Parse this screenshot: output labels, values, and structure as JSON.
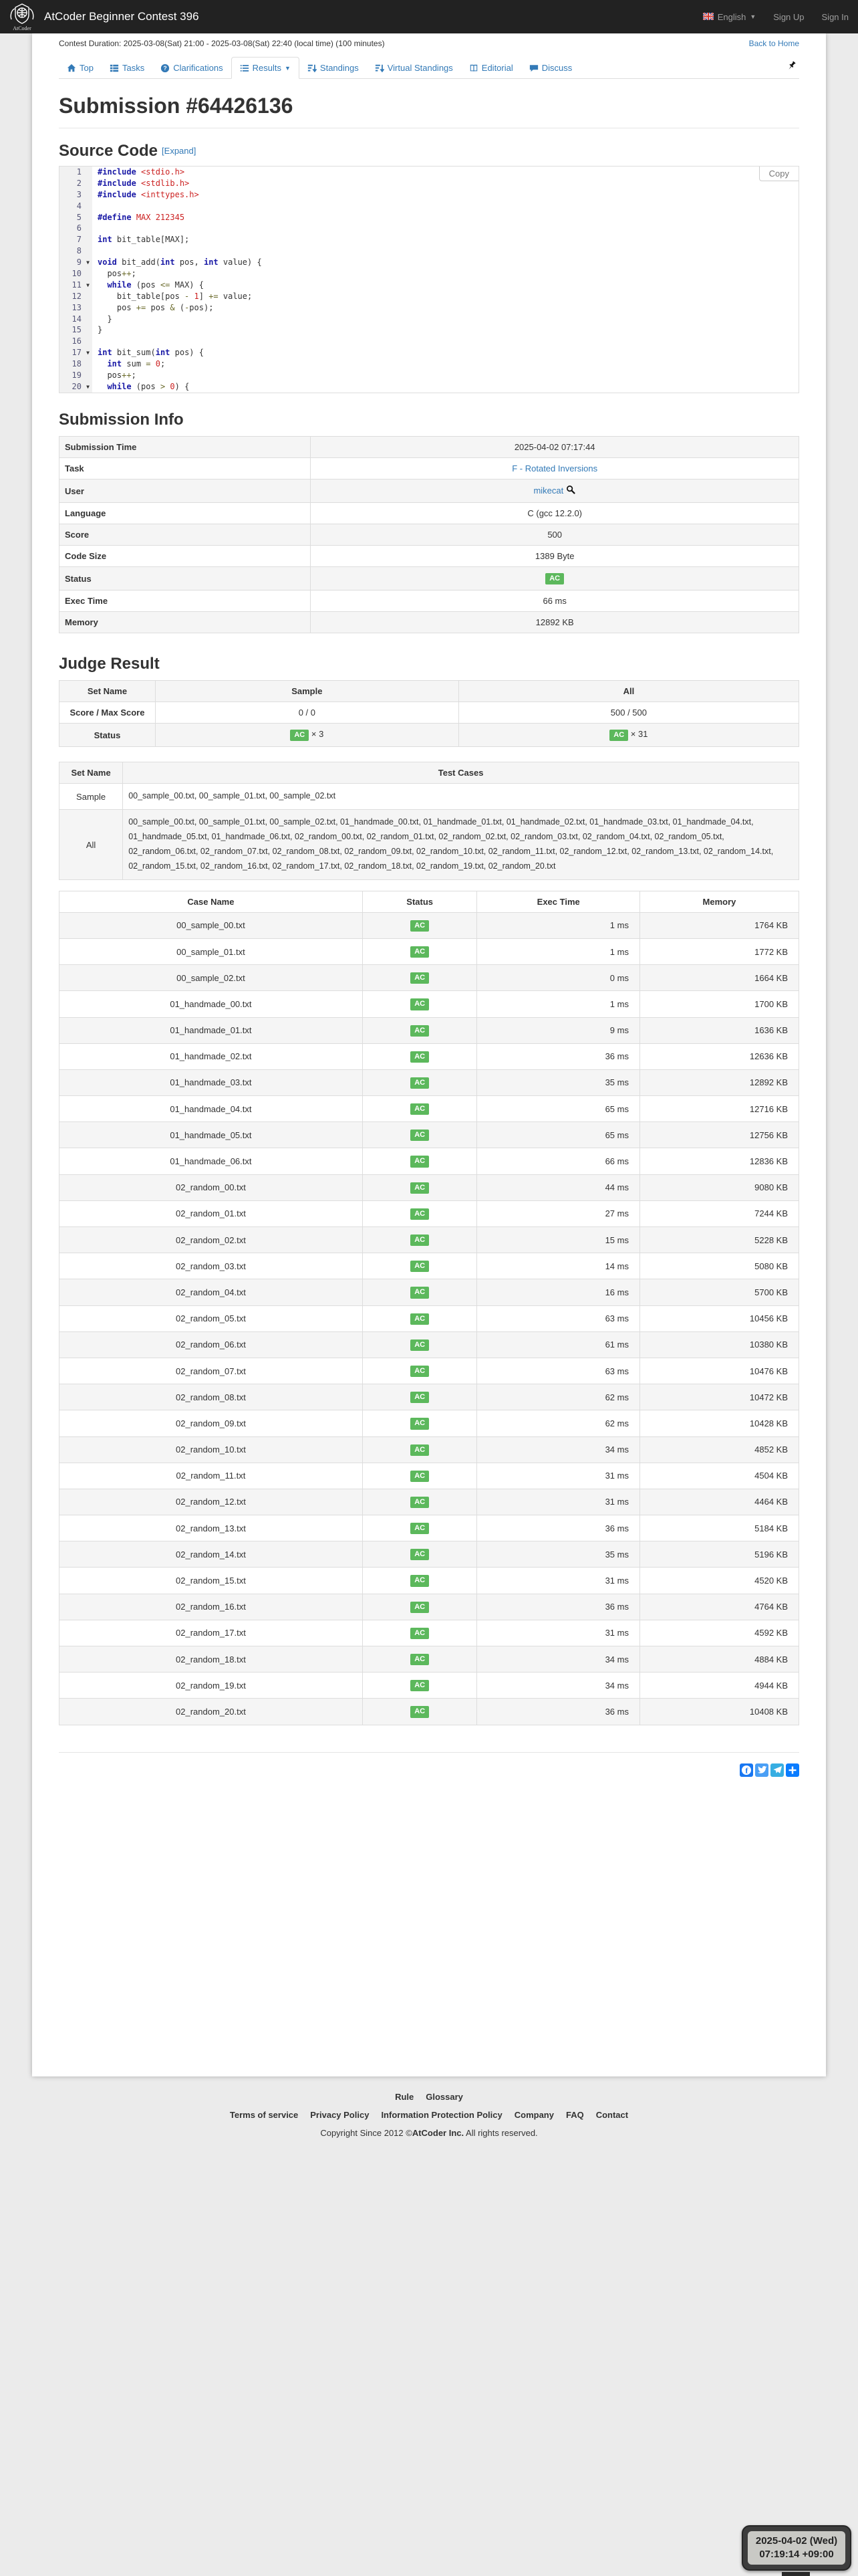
{
  "colors": {
    "accent_link": "#337ab7",
    "ac_green": "#5cb85c",
    "navbar_bg": "#222222",
    "facebook": "#1877f2",
    "twitter": "#4a9ff5",
    "telegram": "#37aee2",
    "more": "#0a7cff"
  },
  "navbar": {
    "brand": "AtCoder Beginner Contest 396",
    "language": "English",
    "sign_up": "Sign Up",
    "sign_in": "Sign In"
  },
  "topbar": {
    "contest_duration": "Contest Duration: 2025-03-08(Sat) 21:00 - 2025-03-08(Sat) 22:40 (local time) (100 minutes)",
    "back_to_home": "Back to Home"
  },
  "tabs": [
    {
      "label": "Top",
      "icon": "home-icon",
      "active": false,
      "caret": false
    },
    {
      "label": "Tasks",
      "icon": "tasks-icon",
      "active": false,
      "caret": false
    },
    {
      "label": "Clarifications",
      "icon": "clarifications-icon",
      "active": false,
      "caret": false
    },
    {
      "label": "Results",
      "icon": "results-icon",
      "active": true,
      "caret": true
    },
    {
      "label": "Standings",
      "icon": "standings-icon",
      "active": false,
      "caret": false
    },
    {
      "label": "Virtual Standings",
      "icon": "virtual-standings-icon",
      "active": false,
      "caret": false
    },
    {
      "label": "Editorial",
      "icon": "editorial-icon",
      "active": false,
      "caret": false
    },
    {
      "label": "Discuss",
      "icon": "discuss-icon",
      "active": false,
      "caret": false
    }
  ],
  "page": {
    "title": "Submission #64426136"
  },
  "source_code": {
    "heading": "Source Code",
    "expand_label": "[Expand]",
    "copy_label": "Copy",
    "lines": [
      {
        "n": "1",
        "fold": false,
        "t": [
          [
            "k",
            "#include"
          ],
          [
            "p",
            " "
          ],
          [
            "s",
            "<stdio.h>"
          ]
        ]
      },
      {
        "n": "2",
        "fold": false,
        "t": [
          [
            "k",
            "#include"
          ],
          [
            "p",
            " "
          ],
          [
            "s",
            "<stdlib.h>"
          ]
        ]
      },
      {
        "n": "3",
        "fold": false,
        "t": [
          [
            "k",
            "#include"
          ],
          [
            "p",
            " "
          ],
          [
            "s",
            "<inttypes.h>"
          ]
        ]
      },
      {
        "n": "4",
        "fold": false,
        "t": []
      },
      {
        "n": "5",
        "fold": false,
        "t": [
          [
            "k",
            "#define"
          ],
          [
            "p",
            " "
          ],
          [
            "l",
            "MAX 212345"
          ]
        ]
      },
      {
        "n": "6",
        "fold": false,
        "t": []
      },
      {
        "n": "7",
        "fold": false,
        "t": [
          [
            "k",
            "int"
          ],
          [
            "p",
            " bit_table[MAX];"
          ]
        ]
      },
      {
        "n": "8",
        "fold": false,
        "t": []
      },
      {
        "n": "9",
        "fold": true,
        "t": [
          [
            "k",
            "void"
          ],
          [
            "p",
            " bit_add("
          ],
          [
            "k",
            "int"
          ],
          [
            "p",
            " pos, "
          ],
          [
            "k",
            "int"
          ],
          [
            "p",
            " value) {"
          ]
        ]
      },
      {
        "n": "10",
        "fold": false,
        "t": [
          [
            "p",
            "  pos"
          ],
          [
            "o",
            "++"
          ],
          [
            "p",
            ";"
          ]
        ]
      },
      {
        "n": "11",
        "fold": true,
        "t": [
          [
            "p",
            "  "
          ],
          [
            "k",
            "while"
          ],
          [
            "p",
            " (pos "
          ],
          [
            "o",
            "<="
          ],
          [
            "p",
            " MAX) {"
          ]
        ]
      },
      {
        "n": "12",
        "fold": false,
        "t": [
          [
            "p",
            "    bit_table[pos "
          ],
          [
            "o",
            "-"
          ],
          [
            "p",
            " "
          ],
          [
            "l",
            "1"
          ],
          [
            "p",
            "] "
          ],
          [
            "o",
            "+="
          ],
          [
            "p",
            " value;"
          ]
        ]
      },
      {
        "n": "13",
        "fold": false,
        "t": [
          [
            "p",
            "    pos "
          ],
          [
            "o",
            "+="
          ],
          [
            "p",
            " pos "
          ],
          [
            "o",
            "&"
          ],
          [
            "p",
            " ("
          ],
          [
            "o",
            "-"
          ],
          [
            "p",
            "pos);"
          ]
        ]
      },
      {
        "n": "14",
        "fold": false,
        "t": [
          [
            "p",
            "  }"
          ]
        ]
      },
      {
        "n": "15",
        "fold": false,
        "t": [
          [
            "p",
            "}"
          ]
        ]
      },
      {
        "n": "16",
        "fold": false,
        "t": []
      },
      {
        "n": "17",
        "fold": true,
        "t": [
          [
            "k",
            "int"
          ],
          [
            "p",
            " bit_sum("
          ],
          [
            "k",
            "int"
          ],
          [
            "p",
            " pos) {"
          ]
        ]
      },
      {
        "n": "18",
        "fold": false,
        "t": [
          [
            "p",
            "  "
          ],
          [
            "k",
            "int"
          ],
          [
            "p",
            " sum "
          ],
          [
            "o",
            "="
          ],
          [
            "p",
            " "
          ],
          [
            "l",
            "0"
          ],
          [
            "p",
            ";"
          ]
        ]
      },
      {
        "n": "19",
        "fold": false,
        "t": [
          [
            "p",
            "  pos"
          ],
          [
            "o",
            "++"
          ],
          [
            "p",
            ";"
          ]
        ]
      },
      {
        "n": "20",
        "fold": true,
        "t": [
          [
            "p",
            "  "
          ],
          [
            "k",
            "while"
          ],
          [
            "p",
            " (pos "
          ],
          [
            "o",
            ">"
          ],
          [
            "p",
            " "
          ],
          [
            "l",
            "0"
          ],
          [
            "p",
            ") {"
          ]
        ]
      }
    ]
  },
  "submission_info": {
    "heading": "Submission Info",
    "rows": [
      {
        "label": "Submission Time",
        "value": "2025-04-02 07:17:44",
        "type": "text"
      },
      {
        "label": "Task",
        "value": "F - Rotated Inversions",
        "type": "link"
      },
      {
        "label": "User",
        "value": "mikecat",
        "type": "user"
      },
      {
        "label": "Language",
        "value": "C (gcc 12.2.0)",
        "type": "text"
      },
      {
        "label": "Score",
        "value": "500",
        "type": "text"
      },
      {
        "label": "Code Size",
        "value": "1389 Byte",
        "type": "text"
      },
      {
        "label": "Status",
        "value": "AC",
        "type": "badge"
      },
      {
        "label": "Exec Time",
        "value": "66 ms",
        "type": "text"
      },
      {
        "label": "Memory",
        "value": "12892 KB",
        "type": "text"
      }
    ]
  },
  "judge_result": {
    "heading": "Judge Result",
    "headers": [
      "Set Name",
      "Sample",
      "All"
    ],
    "score_row": {
      "label": "Score / Max Score",
      "sample": "0 / 0",
      "all": "500 / 500"
    },
    "status_row": {
      "label": "Status",
      "sample_badge": "AC",
      "sample_count": "× 3",
      "all_badge": "AC",
      "all_count": "× 31"
    }
  },
  "test_cases": {
    "headers": [
      "Set Name",
      "Test Cases"
    ],
    "rows": [
      {
        "set": "Sample",
        "cases": "00_sample_00.txt, 00_sample_01.txt, 00_sample_02.txt"
      },
      {
        "set": "All",
        "cases": "00_sample_00.txt, 00_sample_01.txt, 00_sample_02.txt, 01_handmade_00.txt, 01_handmade_01.txt, 01_handmade_02.txt, 01_handmade_03.txt, 01_handmade_04.txt, 01_handmade_05.txt, 01_handmade_06.txt, 02_random_00.txt, 02_random_01.txt, 02_random_02.txt, 02_random_03.txt, 02_random_04.txt, 02_random_05.txt, 02_random_06.txt, 02_random_07.txt, 02_random_08.txt, 02_random_09.txt, 02_random_10.txt, 02_random_11.txt, 02_random_12.txt, 02_random_13.txt, 02_random_14.txt, 02_random_15.txt, 02_random_16.txt, 02_random_17.txt, 02_random_18.txt, 02_random_19.txt, 02_random_20.txt"
      }
    ]
  },
  "case_results": {
    "headers": [
      "Case Name",
      "Status",
      "Exec Time",
      "Memory"
    ],
    "rows": [
      [
        "00_sample_00.txt",
        "AC",
        "1 ms",
        "1764 KB"
      ],
      [
        "00_sample_01.txt",
        "AC",
        "1 ms",
        "1772 KB"
      ],
      [
        "00_sample_02.txt",
        "AC",
        "0 ms",
        "1664 KB"
      ],
      [
        "01_handmade_00.txt",
        "AC",
        "1 ms",
        "1700 KB"
      ],
      [
        "01_handmade_01.txt",
        "AC",
        "9 ms",
        "1636 KB"
      ],
      [
        "01_handmade_02.txt",
        "AC",
        "36 ms",
        "12636 KB"
      ],
      [
        "01_handmade_03.txt",
        "AC",
        "35 ms",
        "12892 KB"
      ],
      [
        "01_handmade_04.txt",
        "AC",
        "65 ms",
        "12716 KB"
      ],
      [
        "01_handmade_05.txt",
        "AC",
        "65 ms",
        "12756 KB"
      ],
      [
        "01_handmade_06.txt",
        "AC",
        "66 ms",
        "12836 KB"
      ],
      [
        "02_random_00.txt",
        "AC",
        "44 ms",
        "9080 KB"
      ],
      [
        "02_random_01.txt",
        "AC",
        "27 ms",
        "7244 KB"
      ],
      [
        "02_random_02.txt",
        "AC",
        "15 ms",
        "5228 KB"
      ],
      [
        "02_random_03.txt",
        "AC",
        "14 ms",
        "5080 KB"
      ],
      [
        "02_random_04.txt",
        "AC",
        "16 ms",
        "5700 KB"
      ],
      [
        "02_random_05.txt",
        "AC",
        "63 ms",
        "10456 KB"
      ],
      [
        "02_random_06.txt",
        "AC",
        "61 ms",
        "10380 KB"
      ],
      [
        "02_random_07.txt",
        "AC",
        "63 ms",
        "10476 KB"
      ],
      [
        "02_random_08.txt",
        "AC",
        "62 ms",
        "10472 KB"
      ],
      [
        "02_random_09.txt",
        "AC",
        "62 ms",
        "10428 KB"
      ],
      [
        "02_random_10.txt",
        "AC",
        "34 ms",
        "4852 KB"
      ],
      [
        "02_random_11.txt",
        "AC",
        "31 ms",
        "4504 KB"
      ],
      [
        "02_random_12.txt",
        "AC",
        "31 ms",
        "4464 KB"
      ],
      [
        "02_random_13.txt",
        "AC",
        "36 ms",
        "5184 KB"
      ],
      [
        "02_random_14.txt",
        "AC",
        "35 ms",
        "5196 KB"
      ],
      [
        "02_random_15.txt",
        "AC",
        "31 ms",
        "4520 KB"
      ],
      [
        "02_random_16.txt",
        "AC",
        "36 ms",
        "4764 KB"
      ],
      [
        "02_random_17.txt",
        "AC",
        "31 ms",
        "4592 KB"
      ],
      [
        "02_random_18.txt",
        "AC",
        "34 ms",
        "4884 KB"
      ],
      [
        "02_random_19.txt",
        "AC",
        "34 ms",
        "4944 KB"
      ],
      [
        "02_random_20.txt",
        "AC",
        "36 ms",
        "10408 KB"
      ]
    ]
  },
  "share": {
    "icons": [
      "facebook-share-icon",
      "twitter-share-icon",
      "telegram-share-icon",
      "more-share-icon"
    ]
  },
  "footer": {
    "links_row1": [
      "Rule",
      "Glossary"
    ],
    "links_row2": [
      "Terms of service",
      "Privacy Policy",
      "Information Protection Policy",
      "Company",
      "FAQ",
      "Contact"
    ],
    "copyright_prefix": "Copyright Since 2012 ©",
    "copyright_brand": "AtCoder Inc.",
    "copyright_suffix": " All rights reserved."
  },
  "clock": {
    "date": "2025-04-02 (Wed)",
    "time": "07:19:14 +09:00"
  }
}
